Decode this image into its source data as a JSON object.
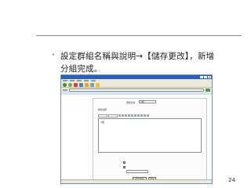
{
  "slide": {
    "bullet_char": "•",
    "text_line1": "設定群組名稱與說明→【儲存更改】，新增",
    "text_line2": "分組完成。",
    "page_number": "24"
  },
  "screenshot": {
    "content": {
      "group_name_label": "群組名稱",
      "group_name_value": "1組",
      "description_label": "群組說明",
      "editor_text": "1組",
      "save_button": "儲存更改",
      "cancel_button": "取消"
    }
  },
  "colors": {
    "bullet": "#3aa6a0",
    "rule": "#8a8a8a",
    "titlebar": "#2b5fb4"
  }
}
